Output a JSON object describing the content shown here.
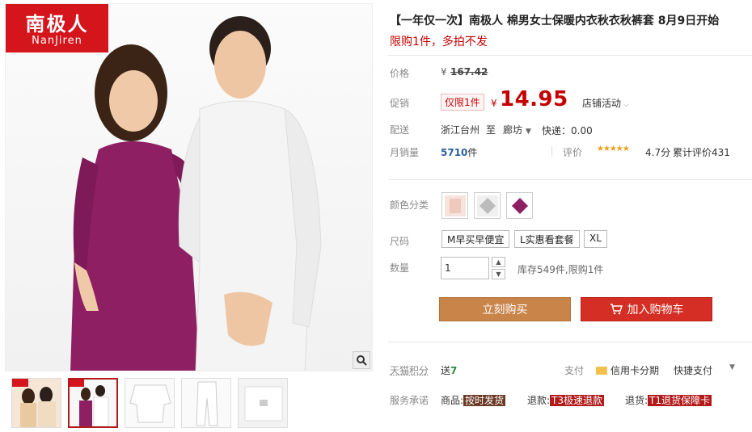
{
  "brand": {
    "cn": "南极人",
    "en": "NanJiren"
  },
  "product": {
    "title": "【一年仅一次】南极人 棉男女士保暖内衣秋衣秋裤套 8月9日开始",
    "subtitle": "限购1件，多拍不发"
  },
  "price": {
    "label": "价格",
    "currency": "¥",
    "original": "167.42"
  },
  "promo": {
    "label": "促销",
    "tag": "仅限1件",
    "currency": "¥",
    "price": "14.95",
    "store_activity": "店铺活动"
  },
  "shipping": {
    "label": "配送",
    "from": "浙江台州",
    "to_word": "至",
    "to": "廊坊",
    "express": "快递：0.00"
  },
  "sales": {
    "label": "月销量",
    "count": "5710",
    "unit": "件",
    "rating_label": "评价",
    "rating": "4.7分",
    "reviews": "累计评价431"
  },
  "options": {
    "color_label": "颜色分类",
    "size_label": "尺码",
    "sizes": [
      "M早买早便宜",
      "L实惠看套餐",
      "XL"
    ],
    "qty_label": "数量",
    "qty_value": "1",
    "stock": "库存549件,限购1件"
  },
  "buttons": {
    "buy": "立刻购买",
    "cart": "加入购物车"
  },
  "footer": {
    "points_label": "天猫积分",
    "points_value": "送",
    "points_num": "7",
    "pay_label": "支付",
    "credit": "信用卡分期",
    "quick_pay": "快捷支付",
    "service_label": "服务承诺",
    "goods_label": "商品:",
    "goods_tag": "按时发货",
    "refund_label": "退款:",
    "refund_tag": "T3极速退款",
    "return_label": "退货:",
    "return_tag": "T1退货保障卡"
  },
  "colors": {
    "accent_red": "#c40000",
    "buy_button": "#c9844a",
    "cart_button": "#d42e25",
    "logo_bg": "#d4151c"
  }
}
